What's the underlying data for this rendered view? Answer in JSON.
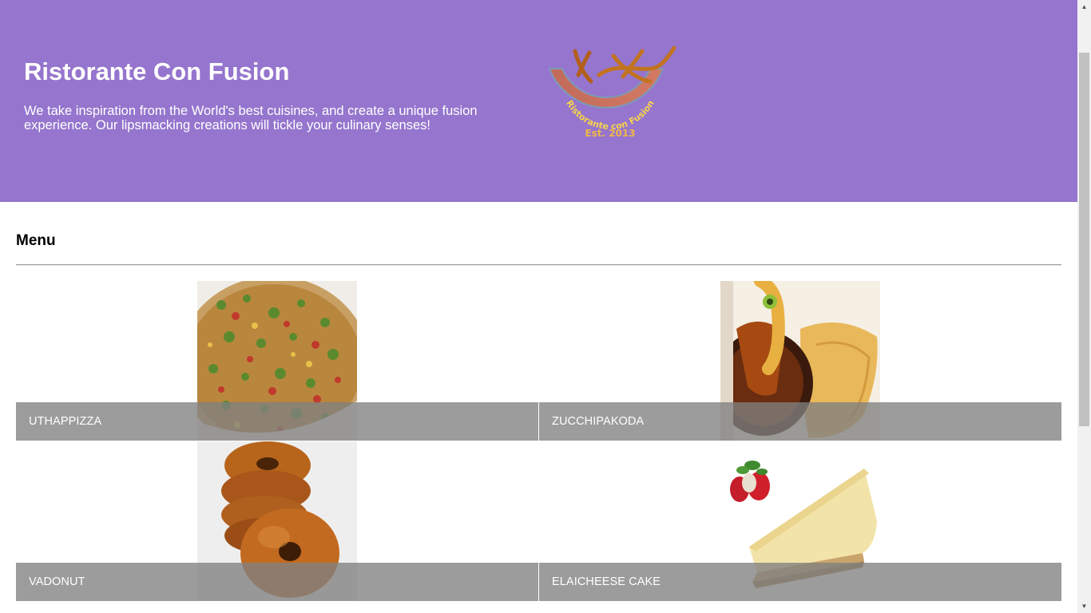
{
  "header": {
    "title": "Ristorante Con Fusion",
    "description": "We take inspiration from the World's best cuisines, and create a unique fusion experience. Our lipsmacking creations will tickle your culinary senses!",
    "logo": {
      "brand_text": "Ristorante con Fusion",
      "established": "Est. 2013"
    }
  },
  "menu": {
    "heading": "Menu",
    "items": [
      {
        "name": "UTHAPPIZZA",
        "image": "pizza"
      },
      {
        "name": "ZUCCHIPAKODA",
        "image": "fritters-with-sauce"
      },
      {
        "name": "VADONUT",
        "image": "stacked-donuts"
      },
      {
        "name": "ELAICHEESE CAKE",
        "image": "cheesecake-slice"
      }
    ]
  },
  "colors": {
    "header_bg": "#9575cd",
    "overlay_bar": "#808080",
    "text_light": "#ffffff"
  }
}
